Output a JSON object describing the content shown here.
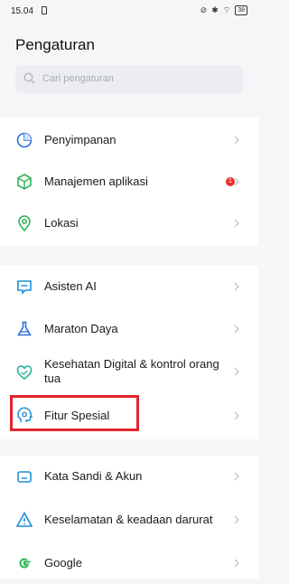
{
  "status_bar": {
    "time": "15.04",
    "battery": "38"
  },
  "header": {
    "title": "Pengaturan"
  },
  "search": {
    "placeholder": "Cari pengaturan"
  },
  "groups": [
    {
      "items": [
        {
          "label": "Penyimpanan",
          "icon": "storage-pie-icon"
        },
        {
          "label": "Manajemen aplikasi",
          "icon": "app-cube-icon",
          "badge": "1"
        },
        {
          "label": "Lokasi",
          "icon": "location-pin-icon"
        }
      ]
    },
    {
      "items": [
        {
          "label": "Asisten AI",
          "icon": "ai-chat-icon"
        },
        {
          "label": "Maraton Daya",
          "icon": "flask-icon"
        },
        {
          "label": "Kesehatan Digital & kontrol orang tua",
          "icon": "heart-icon"
        },
        {
          "label": "Fitur Spesial",
          "icon": "special-head-icon"
        }
      ]
    },
    {
      "items": [
        {
          "label": "Kata Sandi & Akun",
          "icon": "key-icon"
        },
        {
          "label": "Keselamatan & keadaan darurat",
          "icon": "warning-triangle-icon"
        },
        {
          "label": "Google",
          "icon": "google-icon"
        }
      ]
    }
  ],
  "colors": {
    "highlight": "#e0262a",
    "badge": "#e5322d"
  }
}
